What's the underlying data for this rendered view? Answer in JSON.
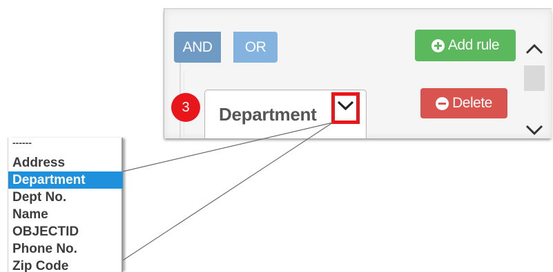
{
  "query_builder": {
    "condition_buttons": {
      "and_label": "AND",
      "or_label": "OR"
    },
    "add_rule_label": "Add rule",
    "delete_label": "Delete",
    "rule_number": "3",
    "field_select": {
      "selected_value": "Department"
    },
    "colors": {
      "and_button": "#6e9ac3",
      "or_button": "#84b3e0",
      "add_button": "#5cb85c",
      "delete_button": "#d9534f",
      "highlight": "#e8151b"
    },
    "icons": {
      "add": "plus-circle-icon",
      "delete": "minus-circle-icon",
      "dropdown": "chevron-down-icon",
      "scroll_up": "chevron-up-icon",
      "scroll_down": "chevron-down-icon"
    }
  },
  "dropdown": {
    "options": [
      "------",
      "Address",
      "Department",
      "Dept No.",
      "Name",
      "OBJECTID",
      "Phone No.",
      "Zip Code"
    ],
    "selected": "Department",
    "selected_color": "#1e90dc"
  }
}
